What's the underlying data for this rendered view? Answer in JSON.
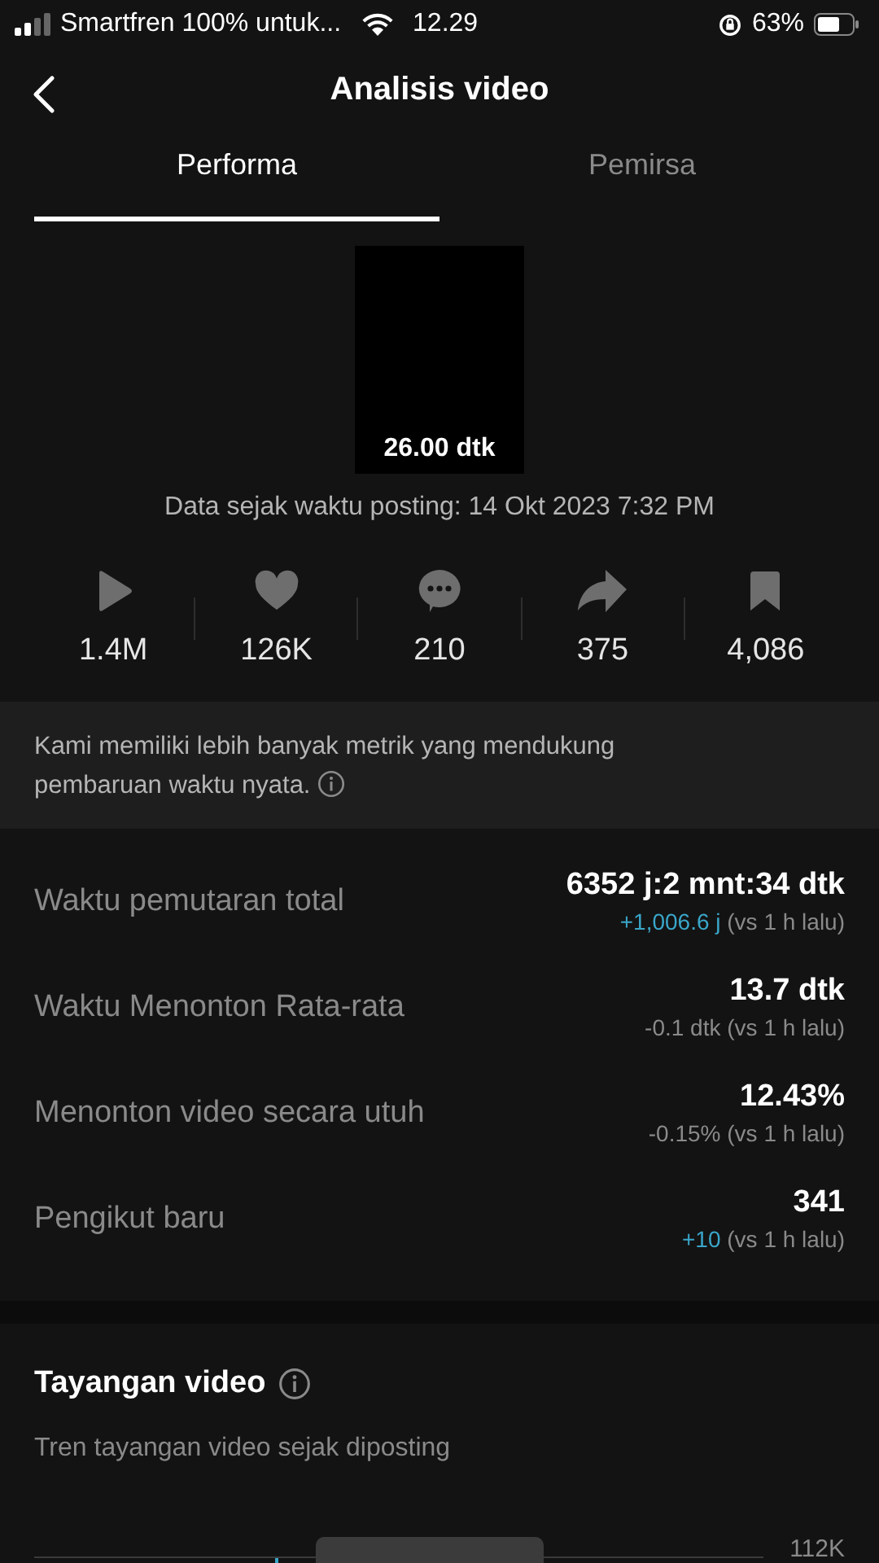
{
  "status_bar": {
    "carrier": "Smartfren 100% untuk...",
    "time": "12.29",
    "battery": "63%"
  },
  "header": {
    "title": "Analisis video"
  },
  "tabs": [
    {
      "label": "Performa",
      "selected": true
    },
    {
      "label": "Pemirsa",
      "selected": false
    }
  ],
  "video": {
    "duration": "26.00 dtk",
    "posted": "Data sejak waktu posting: 14 Okt 2023 7:32 PM"
  },
  "stats": [
    {
      "kind": "plays",
      "value": "1.4M"
    },
    {
      "kind": "likes",
      "value": "126K"
    },
    {
      "kind": "comments",
      "value": "210"
    },
    {
      "kind": "shares",
      "value": "375"
    },
    {
      "kind": "saves",
      "value": "4,086"
    }
  ],
  "notice": "Kami memiliki lebih banyak metrik yang mendukung pembaruan waktu nyata.",
  "metrics": [
    {
      "label": "Waktu pemutaran total",
      "value": "6352 j:2 mnt:34 dtk",
      "change": "+1,006.6 j",
      "color": "#3aa6c9",
      "compare": "(vs 1 h lalu)"
    },
    {
      "label": "Waktu Menonton Rata-rata",
      "value": "13.7 dtk",
      "change": "-0.1 dtk",
      "color": "#8a8a8a",
      "compare": "(vs 1 h lalu)"
    },
    {
      "label": "Menonton video secara utuh",
      "value": "12.43%",
      "change": "-0.15%",
      "color": "#8a8a8a",
      "compare": "(vs 1 h lalu)"
    },
    {
      "label": "Pengikut baru",
      "value": "341",
      "change": "+10",
      "color": "#3aa6c9",
      "compare": "(vs 1 h lalu)"
    }
  ],
  "views_section": {
    "title": "Tayangan video",
    "subtitle": "Tren tayangan video sejak diposting",
    "axis_label": "112K"
  }
}
